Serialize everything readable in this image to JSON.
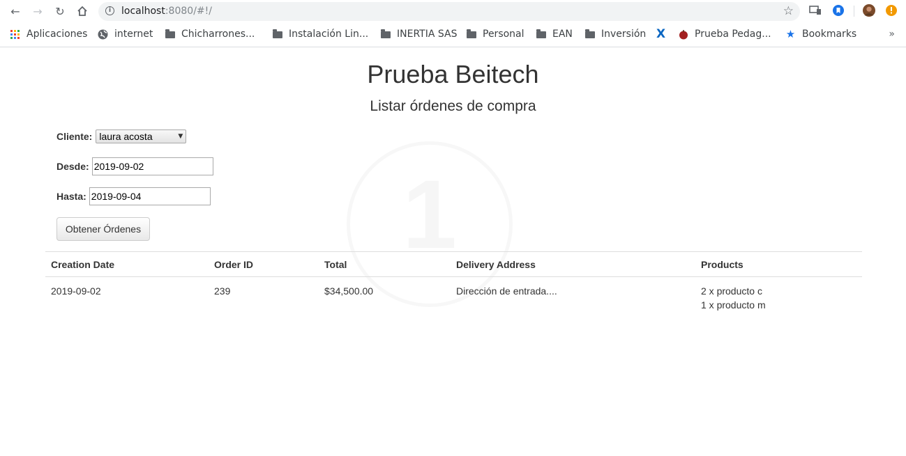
{
  "browser": {
    "url_host": "localhost",
    "url_rest": ":8080/#!/"
  },
  "bookmarks": [
    {
      "label": "Aplicaciones",
      "icon": "apps-icon"
    },
    {
      "label": "internet",
      "icon": "globe-icon"
    },
    {
      "label": "Chicharrones...",
      "icon": "folder-icon"
    },
    {
      "label": "Instalación Lin...",
      "icon": "folder-icon"
    },
    {
      "label": "INERTIA SAS",
      "icon": "folder-icon"
    },
    {
      "label": "Personal",
      "icon": "folder-icon"
    },
    {
      "label": "EAN",
      "icon": "folder-icon"
    },
    {
      "label": "Inversión",
      "icon": "folder-icon"
    },
    {
      "label": "",
      "icon": "x-icon"
    },
    {
      "label": "Prueba Pedag...",
      "icon": "apple-icon"
    },
    {
      "label": "Bookmarks",
      "icon": "star-icon"
    }
  ],
  "page": {
    "title": "Prueba Beitech",
    "subtitle": "Listar órdenes de compra",
    "watermark": "1"
  },
  "form": {
    "cliente_label": "Cliente:",
    "cliente_value": "laura acosta",
    "desde_label": "Desde:",
    "desde_value": "2019-09-02",
    "hasta_label": "Hasta:",
    "hasta_value": "2019-09-04",
    "submit_label": "Obtener Órdenes"
  },
  "table": {
    "headers": [
      "Creation Date",
      "Order ID",
      "Total",
      "Delivery Address",
      "Products"
    ],
    "rows": [
      {
        "creation_date": "2019-09-02",
        "order_id": "239",
        "total": "$34,500.00",
        "delivery_address": "Dirección de entrada....",
        "products": [
          "2 x producto c",
          "1 x producto m"
        ]
      }
    ]
  }
}
